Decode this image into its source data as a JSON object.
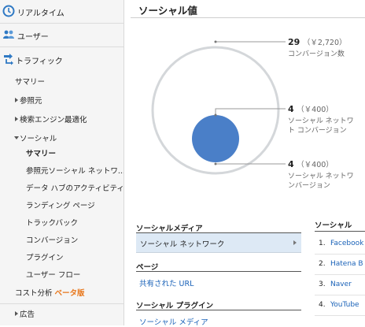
{
  "sidebar": {
    "realtime": "リアルタイム",
    "audience": "ユーザー",
    "traffic": "トラフィック",
    "items": [
      {
        "label": "サマリー"
      },
      {
        "label": "参照元"
      },
      {
        "label": "検索エンジン最適化"
      },
      {
        "label": "ソーシャル"
      },
      {
        "label": "サマリー"
      },
      {
        "label": "参照元ソーシャル ネットワ..."
      },
      {
        "label": "データ ハブのアクティビティ"
      },
      {
        "label": "ランディング ページ"
      },
      {
        "label": "トラックバック"
      },
      {
        "label": "コンバージョン"
      },
      {
        "label": "プラグイン"
      },
      {
        "label": "ユーザー フロー"
      },
      {
        "label": "コスト分析"
      },
      {
        "label": "広告"
      }
    ],
    "beta_label": "ベータ版"
  },
  "main": {
    "title": "ソーシャル値",
    "metrics": [
      {
        "count": "29",
        "value": "（￥2,720）",
        "label1": "コンバージョン数",
        "label2": ""
      },
      {
        "count": "4",
        "value": "（￥400）",
        "label1": "ソーシャル ネットワ",
        "label2": "ト コンバージョン"
      },
      {
        "count": "4",
        "value": "（￥400）",
        "label1": "ソーシャル ネットワ",
        "label2": "ンバージョン"
      }
    ],
    "social_media_header": "ソーシャルメディア",
    "social_network_row": "ソーシャル ネットワーク",
    "pages_header": "ページ",
    "shared_url_link": "共有された URL",
    "social_plugin_header": "ソーシャル プラグイン",
    "social_media_link": "ソーシャル メディア",
    "right_table": {
      "header": "ソーシャル",
      "rows": [
        {
          "num": "1.",
          "name": "Facebook"
        },
        {
          "num": "2.",
          "name": "Hatena B"
        },
        {
          "num": "3.",
          "name": "Naver"
        },
        {
          "num": "4.",
          "name": "YouTube"
        }
      ]
    }
  },
  "colors": {
    "accent_blue": "#4a7fc8",
    "link": "#1a62b8",
    "beta": "#e8761a",
    "selected_row": "#dde9f5"
  }
}
